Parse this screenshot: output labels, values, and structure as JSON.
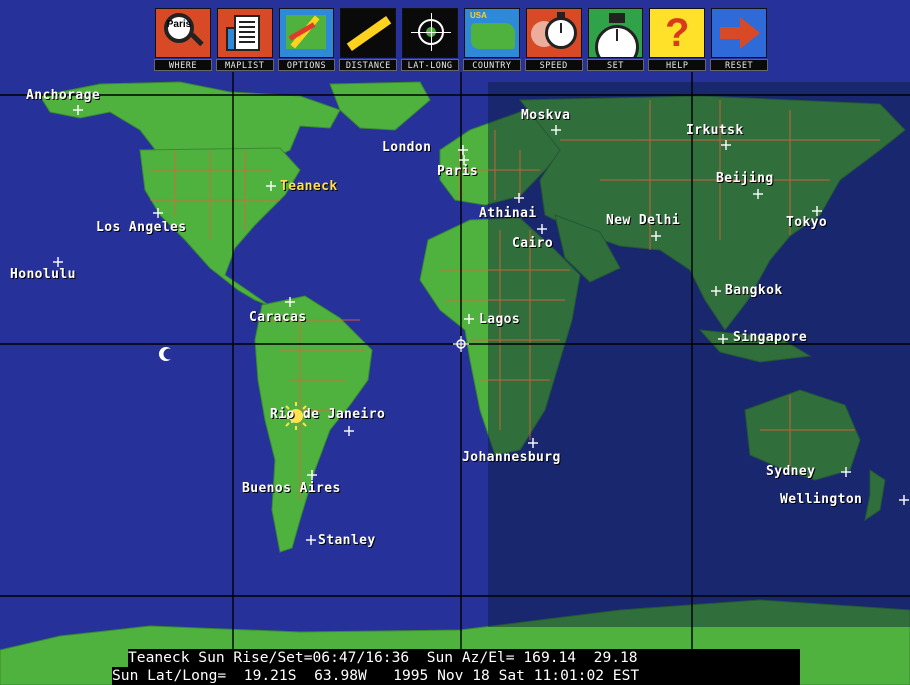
{
  "toolbar": {
    "buttons": [
      {
        "label": "WHERE",
        "icon": "magnifier-paris-icon",
        "icon_text": "Paris"
      },
      {
        "label": "MAPLIST",
        "icon": "map-list-icon"
      },
      {
        "label": "OPTIONS",
        "icon": "options-pencil-icon"
      },
      {
        "label": "DISTANCE",
        "icon": "ruler-icon"
      },
      {
        "label": "LAT-LONG",
        "icon": "crosshair-globe-icon"
      },
      {
        "label": "COUNTRY",
        "icon": "country-map-icon",
        "icon_text": "USA"
      },
      {
        "label": "SPEED",
        "icon": "stopwatch-speed-icon"
      },
      {
        "label": "SET",
        "icon": "set-clock-icon"
      },
      {
        "label": "HELP",
        "icon": "question-mark-icon",
        "icon_text": "?"
      },
      {
        "label": "RESET",
        "icon": "right-arrow-icon"
      }
    ]
  },
  "map": {
    "home_city": "Teaneck",
    "cities": [
      "Anchorage",
      "Los Angeles",
      "Honolulu",
      "Teaneck",
      "Caracas",
      "Rio de Janeiro",
      "Buenos Aires",
      "Stanley",
      "London",
      "Paris",
      "Moskva",
      "Athinai",
      "Cairo",
      "Lagos",
      "Johannesburg",
      "New Delhi",
      "Irkutsk",
      "Beijing",
      "Tokyo",
      "Bangkok",
      "Singapore",
      "Sydney",
      "Wellington"
    ]
  },
  "status": {
    "line1": "Teaneck Sun Rise/Set=06:47/16:36  Sun Az/El= 169.14  29.18",
    "line2": "Sun Lat/Long=  19.21S  63.98W   1995 Nov 18 Sat 11:01:02 EST"
  },
  "colors": {
    "ocean": "#26329a",
    "land_day": "#4fb23f",
    "land_night": "#245a30",
    "night_overlay": "#0c1a3a",
    "border": "#e0603a",
    "grid": "#000000"
  }
}
